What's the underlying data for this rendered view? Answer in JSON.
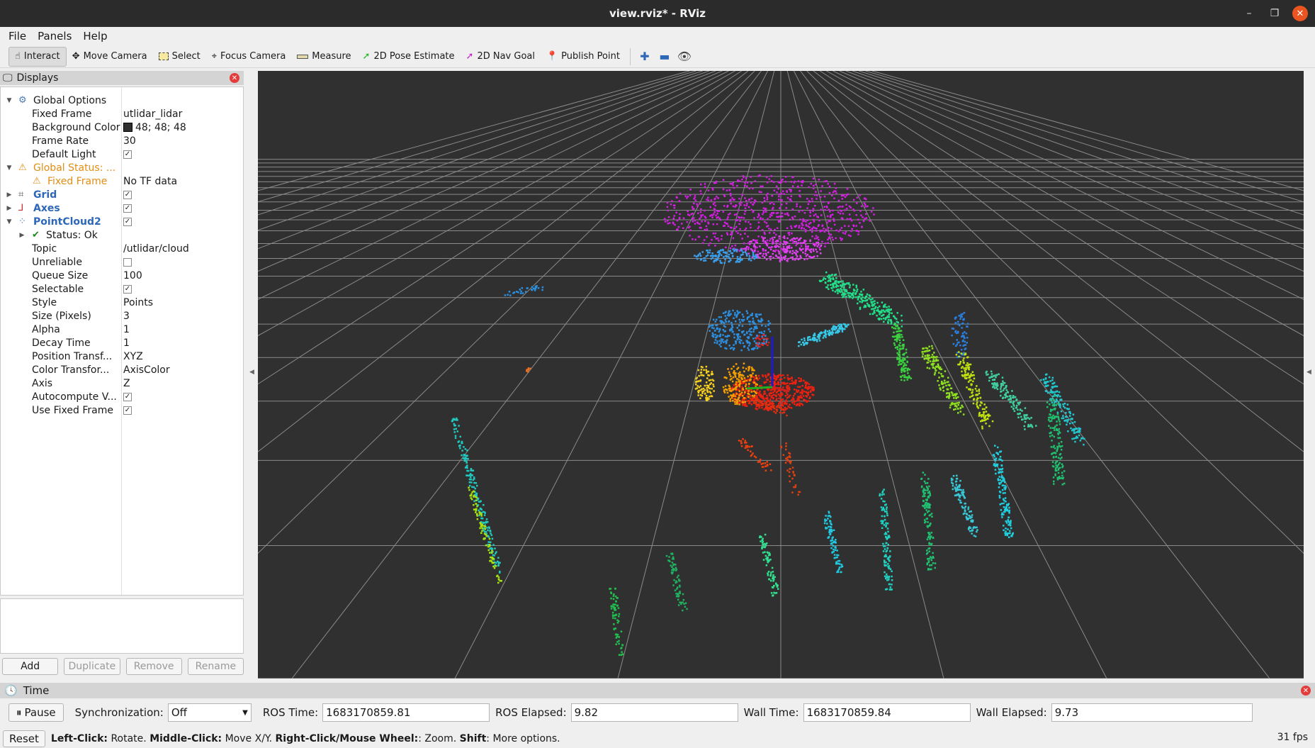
{
  "window": {
    "title": "view.rviz* - RViz"
  },
  "menus": [
    "File",
    "Panels",
    "Help"
  ],
  "toolbar": {
    "tools": [
      {
        "label": "Interact",
        "icon": "cursor-icon"
      },
      {
        "label": "Move Camera",
        "icon": "move-camera-icon"
      },
      {
        "label": "Select",
        "icon": "select-icon"
      },
      {
        "label": "Focus Camera",
        "icon": "focus-camera-icon"
      },
      {
        "label": "Measure",
        "icon": "ruler-icon"
      },
      {
        "label": "2D Pose Estimate",
        "icon": "green-arrow-icon"
      },
      {
        "label": "2D Nav Goal",
        "icon": "magenta-arrow-icon"
      },
      {
        "label": "Publish Point",
        "icon": "pin-icon"
      }
    ],
    "active_tool": "Interact"
  },
  "displays": {
    "title": "Displays",
    "global_options": {
      "label": "Global Options",
      "fixed_frame_label": "Fixed Frame",
      "fixed_frame": "utlidar_lidar",
      "bg_color_label": "Background Color",
      "bg_color": "48; 48; 48",
      "frame_rate_label": "Frame Rate",
      "frame_rate": "30",
      "default_light_label": "Default Light",
      "default_light": true
    },
    "global_status": {
      "label": "Global Status: ...",
      "fixed_frame_label": "Fixed Frame",
      "fixed_frame_value": "No TF data"
    },
    "grid": {
      "label": "Grid",
      "enabled": true
    },
    "axes": {
      "label": "Axes",
      "enabled": true
    },
    "pointcloud": {
      "label": "PointCloud2",
      "enabled": true,
      "status": "Status: Ok",
      "topic_label": "Topic",
      "topic": "/utlidar/cloud",
      "unreliable_label": "Unreliable",
      "unreliable": false,
      "queue_label": "Queue Size",
      "queue": "100",
      "selectable_label": "Selectable",
      "selectable": true,
      "style_label": "Style",
      "style": "Points",
      "size_label": "Size (Pixels)",
      "size": "3",
      "alpha_label": "Alpha",
      "alpha": "1",
      "decay_label": "Decay Time",
      "decay": "1",
      "pos_tf_label": "Position Transf...",
      "pos_tf": "XYZ",
      "color_tf_label": "Color Transfor...",
      "color_tf": "AxisColor",
      "axis_label": "Axis",
      "axis": "Z",
      "autocompute_label": "Autocompute V...",
      "autocompute": true,
      "use_fixed_label": "Use Fixed Frame",
      "use_fixed": true
    },
    "buttons": {
      "add": "Add",
      "duplicate": "Duplicate",
      "remove": "Remove",
      "rename": "Rename"
    }
  },
  "time": {
    "title": "Time",
    "pause": "Pause",
    "sync_label": "Synchronization:",
    "sync": "Off",
    "ros_time_label": "ROS Time:",
    "ros_time": "1683170859.81",
    "ros_elapsed_label": "ROS Elapsed:",
    "ros_elapsed": "9.82",
    "wall_time_label": "Wall Time:",
    "wall_time": "1683170859.84",
    "wall_elapsed_label": "Wall Elapsed:",
    "wall_elapsed": "9.73"
  },
  "status": {
    "reset": "Reset",
    "h1": "Left-Click:",
    "t1": " Rotate. ",
    "h2": "Middle-Click:",
    "t2": " Move X/Y. ",
    "h3": "Right-Click/Mouse Wheel:",
    "t3": ": Zoom. ",
    "h4": "Shift",
    "t4": ": More options.",
    "fps": "31 fps"
  },
  "colors": {
    "viewport_bg": "#303030",
    "accent_blue": "#2d67b8",
    "warning_orange": "#e38d14",
    "close_red": "#e95420"
  }
}
